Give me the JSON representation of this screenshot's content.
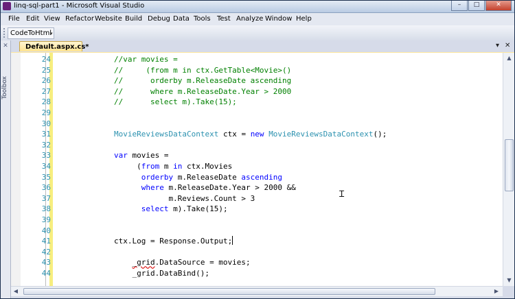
{
  "window": {
    "title": "linq-sql-part1 - Microsoft Visual Studio",
    "minimize": "–",
    "maximize": "□",
    "close": "✕"
  },
  "menu": [
    "File",
    "Edit",
    "View",
    "Refactor",
    "Website",
    "Build",
    "Debug",
    "Data",
    "Tools",
    "Test",
    "Analyze",
    "Window",
    "Help"
  ],
  "toolbar": {
    "button_label": "CodeToHtml",
    "dropdown": "▾"
  },
  "toolbox": {
    "label": "Toolbox",
    "icon": "pin-icon"
  },
  "tabs": [
    {
      "label": "Default.aspx.cs*",
      "active": true
    }
  ],
  "tab_controls": {
    "dropdown": "▾",
    "close": "✕"
  },
  "editor": {
    "lines": [
      {
        "n": "24",
        "indent": 0,
        "tokens": [
          {
            "c": "cm",
            "t": "//var movies ="
          }
        ]
      },
      {
        "n": "25",
        "indent": 0,
        "tokens": [
          {
            "c": "cm",
            "t": "//     (from m in ctx.GetTable<Movie>()"
          }
        ]
      },
      {
        "n": "26",
        "indent": 0,
        "tokens": [
          {
            "c": "cm",
            "t": "//      orderby m.ReleaseDate ascending"
          }
        ]
      },
      {
        "n": "27",
        "indent": 0,
        "tokens": [
          {
            "c": "cm",
            "t": "//      where m.ReleaseDate.Year > 2000"
          }
        ]
      },
      {
        "n": "28",
        "indent": 0,
        "tokens": [
          {
            "c": "cm",
            "t": "//      select m).Take(15);"
          }
        ]
      },
      {
        "n": "29",
        "indent": 0,
        "tokens": []
      },
      {
        "n": "30",
        "indent": 0,
        "tokens": []
      },
      {
        "n": "31",
        "indent": 0,
        "tokens": [
          {
            "c": "ty",
            "t": "MovieReviewsDataContext"
          },
          {
            "c": "tx",
            "t": " ctx = "
          },
          {
            "c": "kw",
            "t": "new"
          },
          {
            "c": "tx",
            "t": " "
          },
          {
            "c": "ty",
            "t": "MovieReviewsDataContext"
          },
          {
            "c": "tx",
            "t": "();"
          }
        ]
      },
      {
        "n": "32",
        "indent": 0,
        "tokens": []
      },
      {
        "n": "33",
        "indent": 0,
        "tokens": [
          {
            "c": "kw",
            "t": "var"
          },
          {
            "c": "tx",
            "t": " movies ="
          }
        ]
      },
      {
        "n": "34",
        "indent": 5,
        "tokens": [
          {
            "c": "tx",
            "t": "("
          },
          {
            "c": "kw",
            "t": "from"
          },
          {
            "c": "tx",
            "t": " m "
          },
          {
            "c": "kw",
            "t": "in"
          },
          {
            "c": "tx",
            "t": " ctx.Movies"
          }
        ]
      },
      {
        "n": "35",
        "indent": 6,
        "tokens": [
          {
            "c": "kw",
            "t": "orderby"
          },
          {
            "c": "tx",
            "t": " m.ReleaseDate "
          },
          {
            "c": "kw",
            "t": "ascending"
          }
        ]
      },
      {
        "n": "36",
        "indent": 6,
        "tokens": [
          {
            "c": "kw",
            "t": "where"
          },
          {
            "c": "tx",
            "t": " m.ReleaseDate.Year > 2000 &&"
          }
        ]
      },
      {
        "n": "37",
        "indent": 12,
        "tokens": [
          {
            "c": "tx",
            "t": "m.Reviews.Count > 3"
          }
        ]
      },
      {
        "n": "38",
        "indent": 6,
        "tokens": [
          {
            "c": "kw",
            "t": "select"
          },
          {
            "c": "tx",
            "t": " m).Take(15);"
          }
        ]
      },
      {
        "n": "39",
        "indent": 0,
        "tokens": []
      },
      {
        "n": "40",
        "indent": 0,
        "tokens": []
      },
      {
        "n": "41",
        "indent": 0,
        "tokens": [
          {
            "c": "tx",
            "t": "ctx.Log = Response.Output;"
          }
        ],
        "caret": true
      },
      {
        "n": "42",
        "indent": 0,
        "tokens": []
      },
      {
        "n": "43",
        "indent": 4,
        "tokens": [
          {
            "c": "tx sq",
            "t": "_grid"
          },
          {
            "c": "tx",
            "t": ".DataSource = movies;"
          }
        ]
      },
      {
        "n": "44",
        "indent": 4,
        "tokens": [
          {
            "c": "tx",
            "t": "_grid.DataBind();"
          }
        ]
      }
    ]
  },
  "scrollbars": {
    "up": "▲",
    "down": "▼",
    "left": "◀",
    "right": "▶"
  },
  "colors": {
    "comment": "#008000",
    "keyword": "#0000ff",
    "type": "#2b91af",
    "line_number": "#2b91af",
    "change_bar": "#f7ee7f",
    "active_tab": "#ffe391"
  }
}
